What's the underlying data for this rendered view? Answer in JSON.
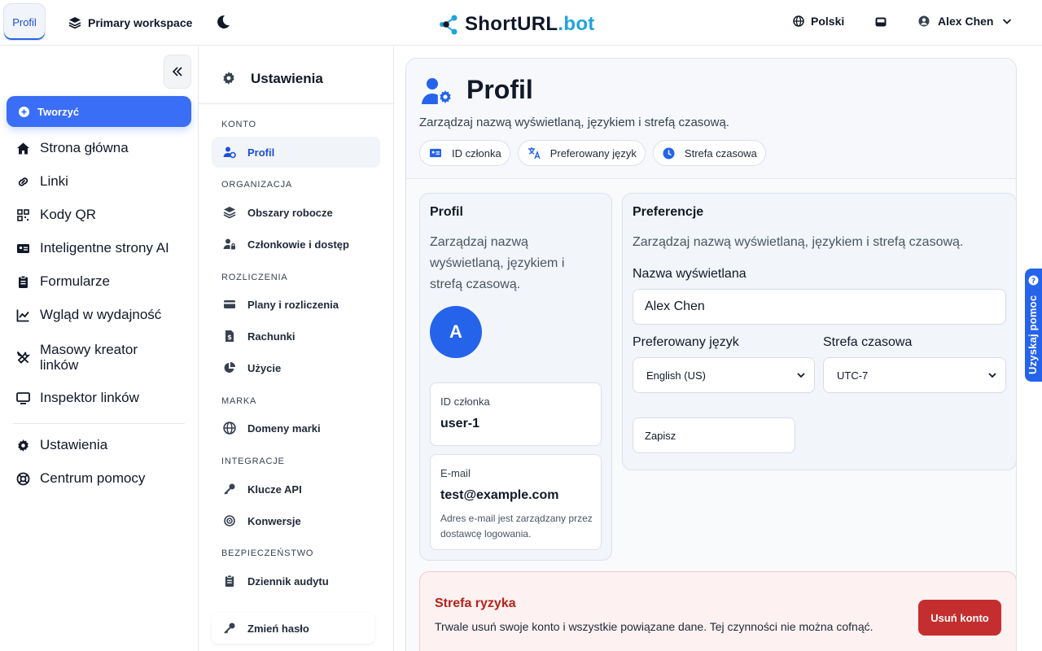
{
  "topbar": {
    "active_tab": "Profil",
    "workspace": "Primary workspace",
    "logo_main": "ShortURL",
    "logo_suffix": ".bot",
    "language": "Polski",
    "user_name": "Alex Chen"
  },
  "sidebar": {
    "create_label": "Tworzyć",
    "items": [
      {
        "label": "Strona główna",
        "icon": "home-icon"
      },
      {
        "label": "Linki",
        "icon": "link-icon"
      },
      {
        "label": "Kody QR",
        "icon": "qr-icon"
      },
      {
        "label": "Inteligentne strony AI",
        "icon": "id-card-icon"
      },
      {
        "label": "Formularze",
        "icon": "clipboard-icon"
      },
      {
        "label": "Wgląd w wydajność",
        "icon": "chart-icon"
      },
      {
        "label": "Masowy kreator linków",
        "icon": "tools-icon"
      },
      {
        "label": "Inspektor linków",
        "icon": "monitor-icon"
      }
    ],
    "footer_items": [
      {
        "label": "Ustawienia",
        "icon": "gear-icon"
      },
      {
        "label": "Centrum pomocy",
        "icon": "lifebuoy-icon"
      }
    ]
  },
  "settings_nav": {
    "title": "Ustawienia",
    "sections": {
      "account": "KONTO",
      "organization": "ORGANIZACJA",
      "billing": "ROZLICZENIA",
      "brand": "MARKA",
      "integrations": "INTEGRACJE",
      "security": "BEZPIECZEŃSTWO"
    },
    "items": {
      "profile": "Profil",
      "workspaces": "Obszary robocze",
      "members": "Członkowie i dostęp",
      "plans": "Plany i rozliczenia",
      "invoices": "Rachunki",
      "usage": "Użycie",
      "domains": "Domeny marki",
      "api_keys": "Klucze API",
      "conversions": "Konwersje",
      "audit_log": "Dziennik audytu",
      "change_password": "Zmień hasło"
    }
  },
  "page": {
    "title": "Profil",
    "subtitle": "Zarządzaj nazwą wyświetlaną, językiem i strefą czasową.",
    "chips": [
      "ID członka",
      "Preferowany język",
      "Strefa czasowa"
    ]
  },
  "profile_card": {
    "title": "Profil",
    "desc": "Zarządzaj nazwą wyświetlaną, językiem i strefą czasową.",
    "avatar_letter": "A",
    "member_id_label": "ID członka",
    "member_id_value": "user-1",
    "email_label": "E-mail",
    "email_value": "test@example.com",
    "email_note": "Adres e-mail jest zarządzany przez dostawcę logowania."
  },
  "preferences": {
    "title": "Preferencje",
    "desc": "Zarządzaj nazwą wyświetlaną, językiem i strefą czasową.",
    "display_name_label": "Nazwa wyświetlana",
    "display_name_value": "Alex Chen",
    "language_label": "Preferowany język",
    "language_value": "English (US)",
    "timezone_label": "Strefa czasowa",
    "timezone_value": "UTC-7",
    "save_label": "Zapisz"
  },
  "danger_zone": {
    "title": "Strefa ryzyka",
    "desc": "Trwale usuń swoje konto i wszystkie powiązane dane. Tej czynności nie można cofnąć.",
    "button": "Usuń konto"
  },
  "help_tab": "Uzyskaj pomoc",
  "colors": {
    "accent": "#2563eb",
    "danger": "#c52e2e",
    "logo_suffix": "#1fa3dc"
  }
}
